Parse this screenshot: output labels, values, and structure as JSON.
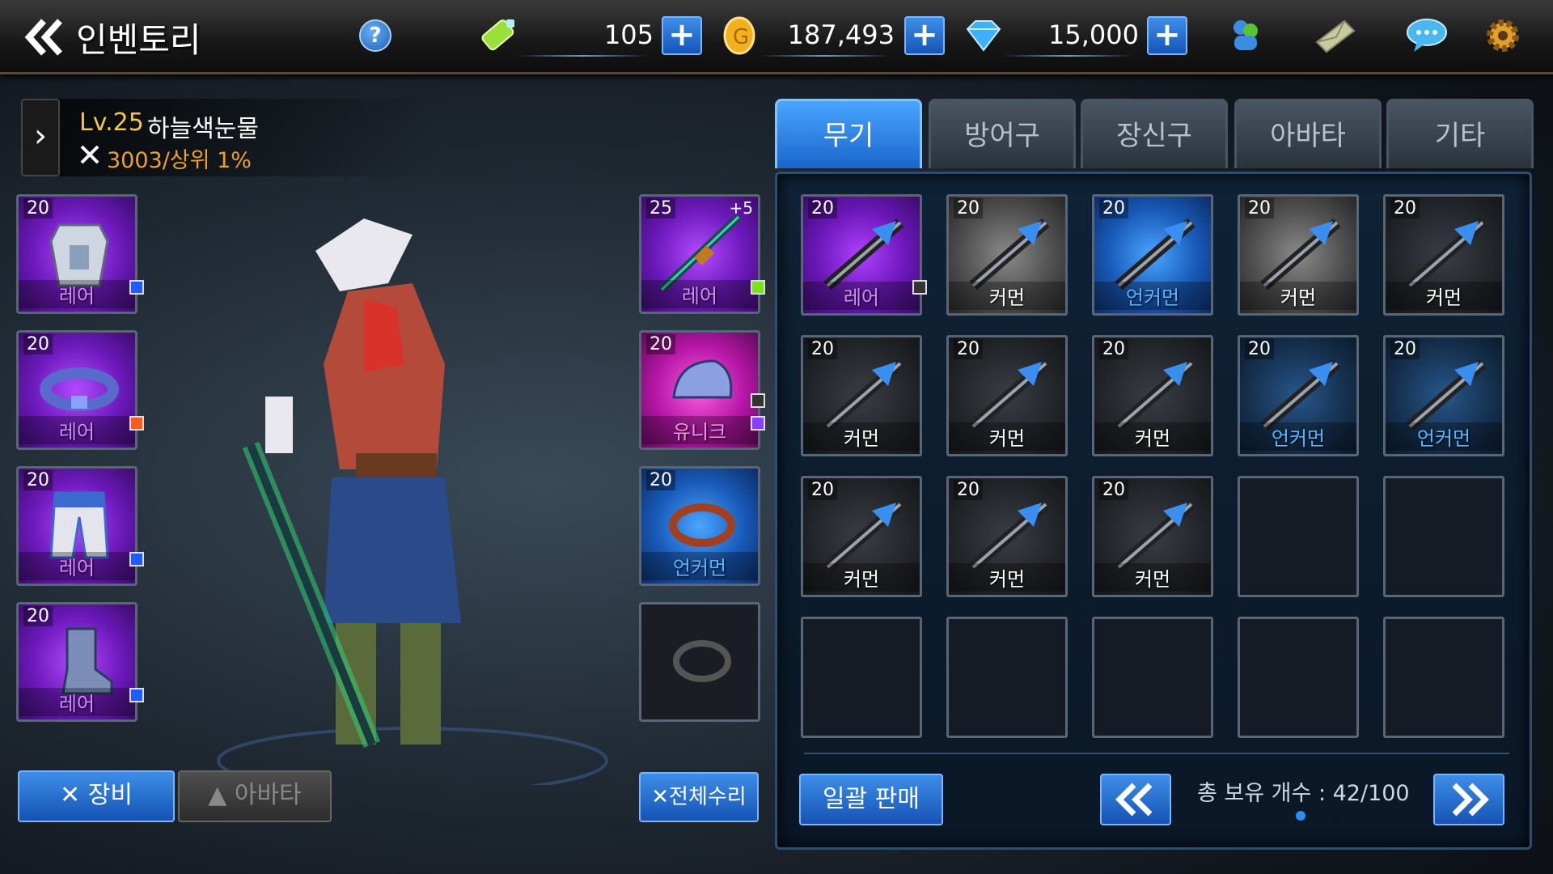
{
  "header": {
    "title": "인벤토리",
    "help": "?"
  },
  "resources": [
    {
      "name": "stamina",
      "icon": "energy-battery-icon",
      "value": "105"
    },
    {
      "name": "gold",
      "icon": "gold-coin-icon",
      "value": "187,493"
    },
    {
      "name": "diamond",
      "icon": "diamond-icon",
      "value": "15,000"
    }
  ],
  "plus_label": "+",
  "profile": {
    "level": "Lv.25",
    "name": "하늘색눈물",
    "power": "3003/상위 1%"
  },
  "equipped_left": [
    {
      "level": "20",
      "grade": "레어",
      "item": "armor",
      "gem": "#1e5cff"
    },
    {
      "level": "20",
      "grade": "레어",
      "item": "belt",
      "gem": "#ff5a1e"
    },
    {
      "level": "20",
      "grade": "레어",
      "item": "pants",
      "gem": "#1e5cff"
    },
    {
      "level": "20",
      "grade": "레어",
      "item": "boots",
      "gem": "#1e5cff"
    }
  ],
  "equipped_right": [
    {
      "level": "25",
      "plus": "+5",
      "grade": "레어",
      "item": "sword",
      "gem": "#7be01e"
    },
    {
      "level": "20",
      "grade": "유니크",
      "item": "shoulder",
      "gem": "#8a3cff"
    },
    {
      "level": "20",
      "grade": "언커먼",
      "item": "necklace",
      "gem": ""
    },
    {
      "level": "",
      "grade": "",
      "item": "ring",
      "gem": ""
    }
  ],
  "buttons": {
    "equip": "장비",
    "avatar": "아바타",
    "repair": "전체수리",
    "sell": "일괄 판매"
  },
  "tabs": [
    "무기",
    "방어구",
    "장신구",
    "아바타",
    "기타"
  ],
  "inventory": [
    {
      "level": "20",
      "grade": "레어",
      "kind": "rare"
    },
    {
      "level": "20",
      "grade": "커먼",
      "kind": "common"
    },
    {
      "level": "20",
      "grade": "언커먼",
      "kind": "uncommon"
    },
    {
      "level": "20",
      "grade": "커먼",
      "kind": "common"
    },
    {
      "level": "20",
      "grade": "커먼",
      "kind": "dark"
    },
    {
      "level": "20",
      "grade": "커먼",
      "kind": "dark"
    },
    {
      "level": "20",
      "grade": "커먼",
      "kind": "dark"
    },
    {
      "level": "20",
      "grade": "커먼",
      "kind": "dark"
    },
    {
      "level": "20",
      "grade": "언커먼",
      "kind": "blueg"
    },
    {
      "level": "20",
      "grade": "언커먼",
      "kind": "blueg"
    },
    {
      "level": "20",
      "grade": "커먼",
      "kind": "dark"
    },
    {
      "level": "20",
      "grade": "커먼",
      "kind": "dark"
    },
    {
      "level": "20",
      "grade": "커먼",
      "kind": "dark"
    }
  ],
  "empty_slots": 7,
  "count_text": "총 보유 개수 : 42/100",
  "colors": {
    "accent": "#1a66cc",
    "rare": "#d58cff",
    "unique": "#ff8cf0",
    "uncommon": "#5ab4ff",
    "gold_text": "#f3c54a"
  }
}
